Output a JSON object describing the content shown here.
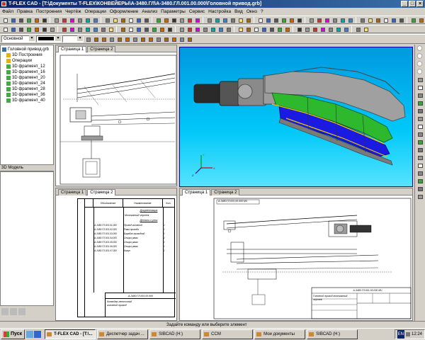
{
  "window": {
    "title": "T-FLEX CAD - [T:\\Документы T-FLEX\\КОНВЕЙЕРЫ\\А-3480.ГЛ\\А-3480.ГЛ.001.00.000\\Головной привод.grb]"
  },
  "menu": [
    "Файл",
    "Правка",
    "Построения",
    "Чертёж",
    "Операции",
    "Оформление",
    "Анализ",
    "Параметры",
    "Сервис",
    "Настройка",
    "Вид",
    "Окно",
    "?"
  ],
  "toolbar": {
    "layer_combo": "Основной"
  },
  "tree": {
    "header": "",
    "items": [
      {
        "label": "Головной привод.grb",
        "indent": 0
      },
      {
        "label": "3D Построения",
        "indent": 1
      },
      {
        "label": "Операции",
        "indent": 1
      },
      {
        "label": "3D фрагмент_12",
        "indent": 1
      },
      {
        "label": "3D фрагмент_16",
        "indent": 1
      },
      {
        "label": "3D фрагмент_20",
        "indent": 1
      },
      {
        "label": "3D фрагмент_24",
        "indent": 1
      },
      {
        "label": "3D фрагмент_28",
        "indent": 1
      },
      {
        "label": "3D фрагмент_36",
        "indent": 1
      },
      {
        "label": "3D фрагмент_40",
        "indent": 1
      }
    ],
    "lower_header": "3D Модель"
  },
  "windows": {
    "top_left_tabs": [
      "Страница 1",
      "Страница 2"
    ],
    "bottom_left_tabs": [
      "Страница 1",
      "Страница 2"
    ],
    "bottom_right_tabs": [
      "Страница 1",
      "Страница 2"
    ]
  },
  "spec": {
    "header_col1": "Обозначение",
    "header_col2": "Наименование",
    "header_col3": "Кол.",
    "section1": "Документация",
    "section2": "Детали и узлы",
    "doc_row": "Монтажный чертеж",
    "rows": [
      {
        "oboz": "А-3480.ГЛ.001.01.000",
        "name": "Привод головной",
        "qty": "1"
      },
      {
        "oboz": "А-3480.ГЛ.001.02.000",
        "name": "Рама привода",
        "qty": "1"
      },
      {
        "oboz": "А-3480.ГЛ.001.03.000",
        "name": "Барабан приводной",
        "qty": "1"
      },
      {
        "oboz": "А-3480.ГЛ.001.04.000",
        "name": "Секция рамы",
        "qty": "2"
      },
      {
        "oboz": "А-3480.ГЛ.001.05.000",
        "name": "Секция рамы",
        "qty": "1"
      },
      {
        "oboz": "А-3480.ГЛ.001.06.000",
        "name": "Секция рамы",
        "qty": "1"
      },
      {
        "oboz": "А-3480.ГЛ.001.07.000",
        "name": "Кожух",
        "qty": "1"
      }
    ],
    "stamp_code": "А-3480.ГЛ.001.00.000",
    "stamp_name": "Конвейер ленточный головной привод"
  },
  "drawing": {
    "stamp_code": "А-3480.ГЛ.001.00.000 МЧ",
    "stamp_name": "Головной привод монтажный чертеж",
    "header_code": "А-3480.ГЛ.001.00.000 МЧ"
  },
  "status": {
    "text": "Задайте команду или выберите элемент"
  },
  "taskbar": {
    "start": "Пуск",
    "tasks": [
      {
        "label": "T-FLEX CAD - [T:\\...",
        "active": true
      },
      {
        "label": "Диспетчер задач ...",
        "active": false
      },
      {
        "label": "SIBCAD (H:)",
        "active": false
      },
      {
        "label": "CCM",
        "active": false
      },
      {
        "label": "Мои документы",
        "active": false
      },
      {
        "label": "SIBCAD (H:)",
        "active": false
      }
    ],
    "lang": "EN",
    "time": "12:24"
  },
  "colors": {
    "titlebar_start": "#0a246a",
    "viewport_bg": "#00b0f0",
    "model_green": "#2eb82e",
    "model_blue": "#1a1ae0",
    "model_gray": "#9a9a9a"
  }
}
